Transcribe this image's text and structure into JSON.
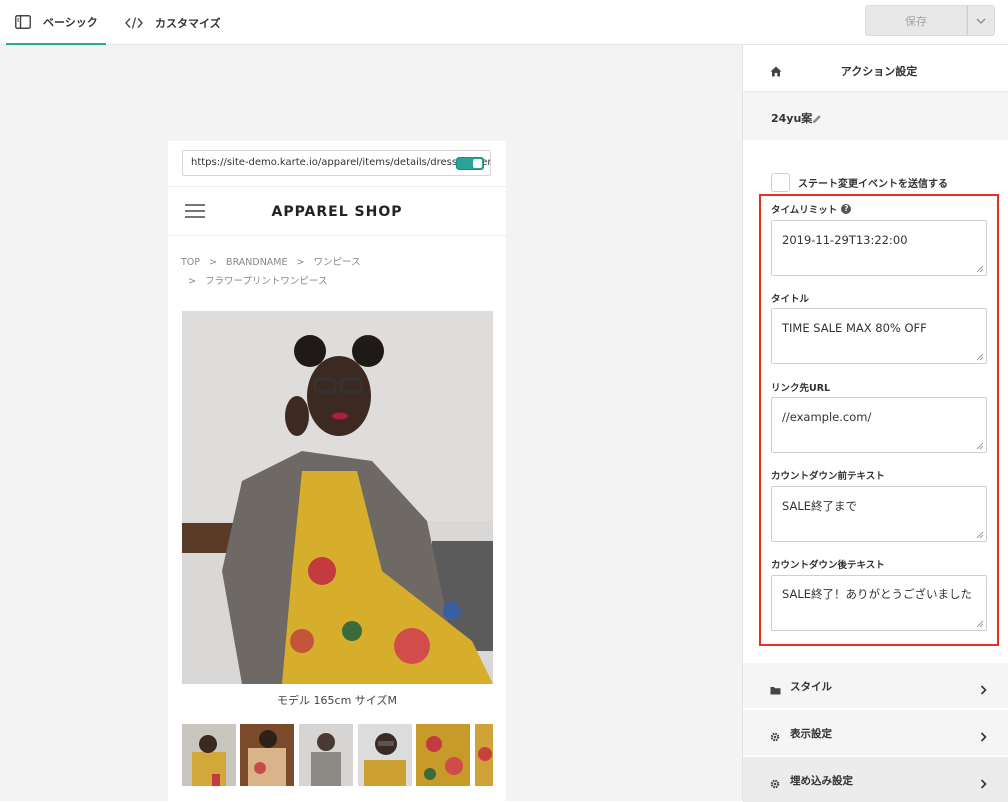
{
  "topbar": {
    "tabs": [
      {
        "label": "ベーシック",
        "icon": "panel-layout-icon",
        "active": true
      },
      {
        "label": "カスタマイズ",
        "icon": "code-icon",
        "active": false
      }
    ],
    "save_label": "保存",
    "accent_color": "#2aa39a"
  },
  "preview": {
    "url": "https://site-demo.karte.io/apparel/items/details/dress-flower",
    "shop_title": "APPAREL SHOP",
    "breadcrumb": [
      "TOP",
      "BRANDNAME",
      "ワンピース",
      "フラワープリントワンピース"
    ],
    "caption": "モデル 165cm サイズM"
  },
  "panel": {
    "title": "アクション設定",
    "name": "24yu案",
    "checkbox_label": "ステート変更イベントを送信する",
    "fields": [
      {
        "label": "タイムリミット",
        "value": "2019-11-29T13:22:00",
        "help": true
      },
      {
        "label": "タイトル",
        "value": "TIME SALE MAX 80% OFF",
        "help": false
      },
      {
        "label": "リンク先URL",
        "value": "//example.com/",
        "help": false
      },
      {
        "label": "カウントダウン前テキスト",
        "value": "SALE終了まで",
        "help": false
      },
      {
        "label": "カウントダウン後テキスト",
        "value": "SALE終了！ありがとうございました",
        "help": false
      }
    ],
    "sections": [
      {
        "label": "スタイル",
        "icon": "folder-icon"
      },
      {
        "label": "表示設定",
        "icon": "gear-icon"
      },
      {
        "label": "埋め込み設定",
        "icon": "gear-icon"
      }
    ],
    "highlight_color": "#e5311f"
  }
}
